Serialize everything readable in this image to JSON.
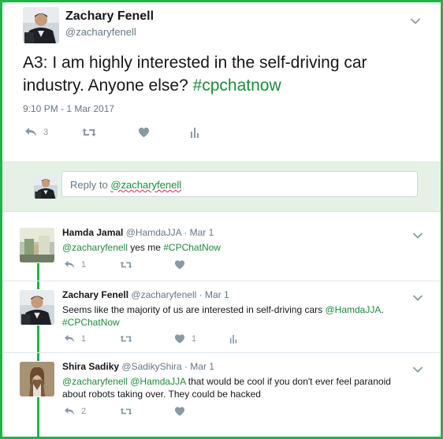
{
  "main_tweet": {
    "author_name": "Zachary Fenell",
    "author_handle": "@zacharyfenell",
    "text_prefix": "A3: I am highly interested in the self-driving car industry. Anyone else? ",
    "hashtag": "#cpchatnow",
    "timestamp": "9:10 PM - 1 Mar 2017",
    "reply_count": "3",
    "icons": [
      "reply-icon",
      "retweet-icon",
      "heart-icon",
      "analytics-icon"
    ]
  },
  "reply_box": {
    "prefix": "Reply to ",
    "mention": "@zacharyfenell"
  },
  "replies": [
    {
      "name": "Hamda Jamal",
      "handle": "@HamdaJJA",
      "date": "Mar 1",
      "text_mention": "@zacharyfenell",
      "text_body": " yes me ",
      "text_hashtag": "#CPChatNow",
      "reply_count": "1",
      "like_count": ""
    },
    {
      "name": "Zachary Fenell",
      "handle": "@zacharyfenell",
      "date": "Mar 1",
      "text_body": "Seems like the majority of us are interested in self-driving cars ",
      "text_mention": "@HamdaJJA",
      "text_tail": ".",
      "text_hashtag": "#CPChatNow",
      "reply_count": "1",
      "like_count": "1"
    },
    {
      "name": "Shira Sadiky",
      "handle": "@SadikyShira",
      "date": "Mar 1",
      "text_mention1": "@zacharyfenell",
      "text_mention2": "@HamdaJJA",
      "text_body": " that would be cool if you don't ever feel paranoid about robots taking over. They could be hacked",
      "reply_count": "2",
      "like_count": ""
    }
  ],
  "colors": {
    "frame_border": "#22b24c",
    "link_green": "#1f8a3a",
    "reply_bar_bg": "#e6f1e6",
    "icon_gray": "#8899a6"
  }
}
